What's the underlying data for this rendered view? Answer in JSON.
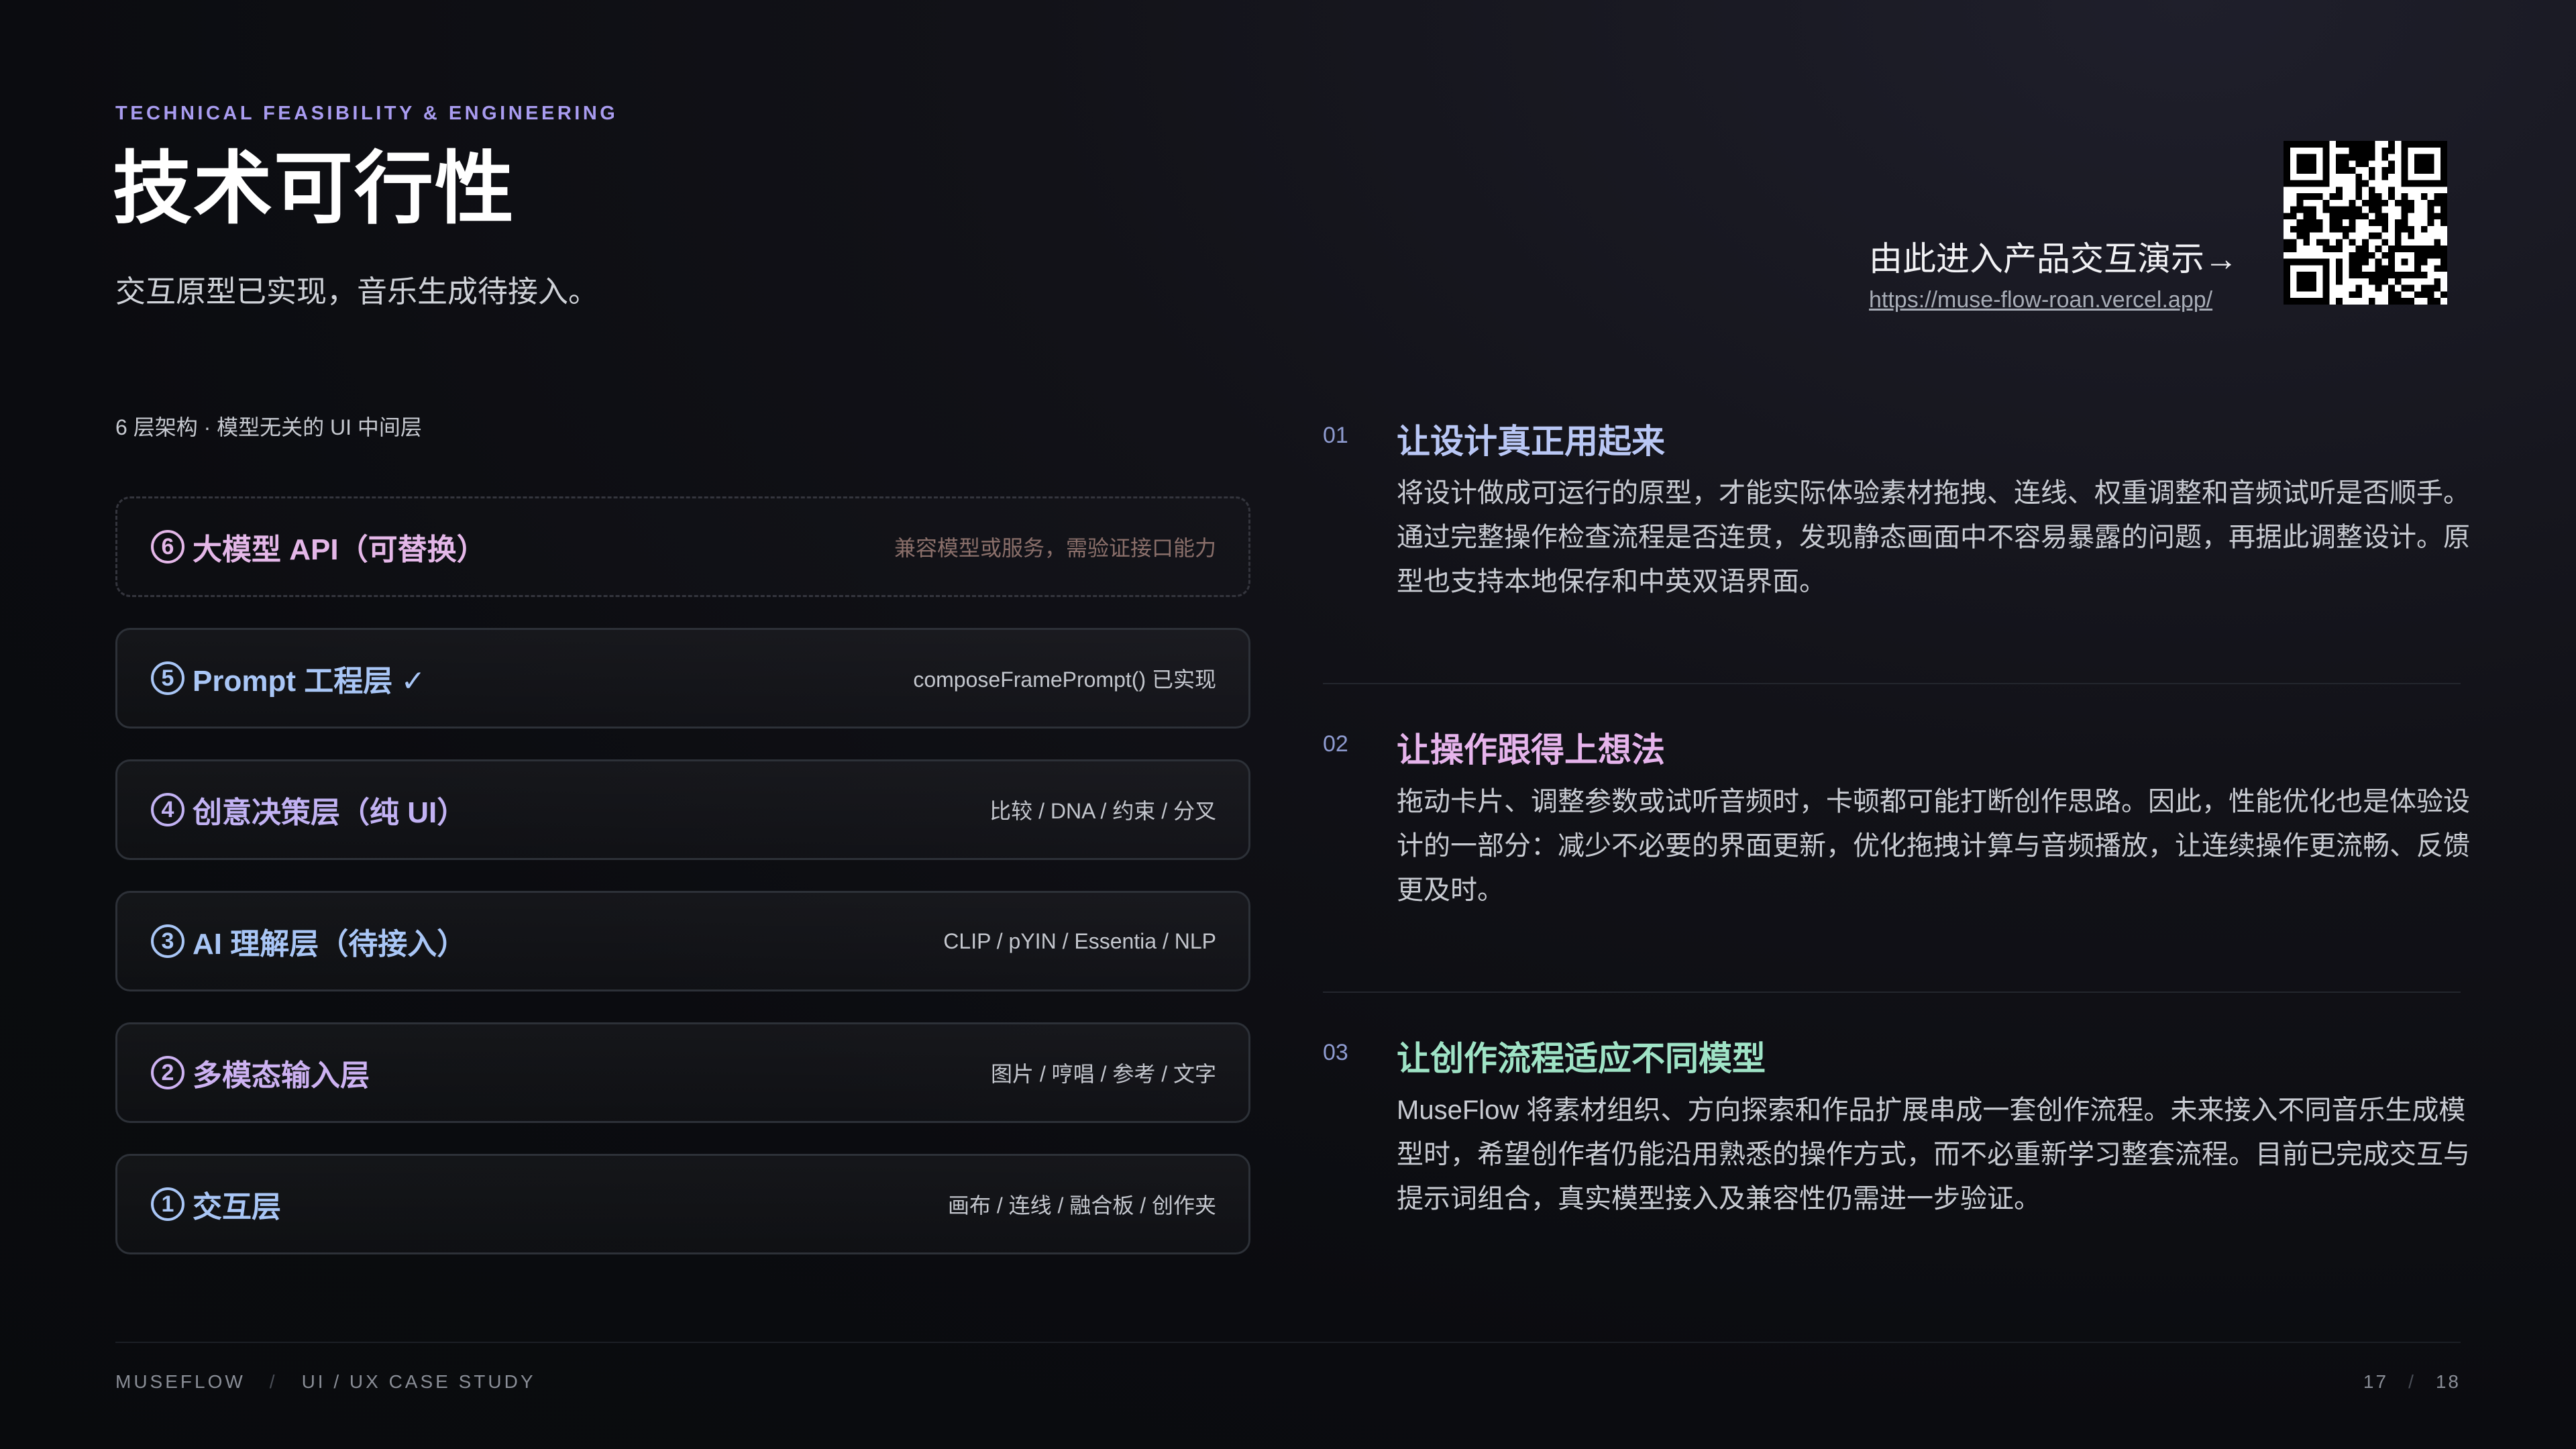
{
  "header": {
    "eyebrow": "TECHNICAL FEASIBILITY & ENGINEERING",
    "title": "技术可行性",
    "subtitle": "交互原型已实现，音乐生成待接入。"
  },
  "demo": {
    "label": "由此进入产品交互演示→",
    "url": "https://muse-flow-roan.vercel.app/",
    "qr_icon": "qr-code-icon"
  },
  "architecture": {
    "caption": "6 层架构 · 模型无关的 UI 中间层",
    "layers": [
      {
        "num": "6",
        "name": "大模型 API（可替换）",
        "detail": "兼容模型或服务，需验证接口能力",
        "color": "#e4b7e8",
        "style": "dashed"
      },
      {
        "num": "5",
        "name": "Prompt 工程层 ✓",
        "detail": "composeFramePrompt() 已实现",
        "color": "#a9c6f6",
        "style": "solid"
      },
      {
        "num": "4",
        "name": "创意决策层（纯 UI）",
        "detail": "比较 / DNA / 约束 / 分叉",
        "color": "#c2b2f3",
        "style": "solid"
      },
      {
        "num": "3",
        "name": "AI 理解层（待接入）",
        "detail": "CLIP / pYIN / Essentia / NLP",
        "color": "#a9c6f6",
        "style": "solid"
      },
      {
        "num": "2",
        "name": "多模态输入层",
        "detail": "图片 / 哼唱 / 参考 / 文字",
        "color": "#cdb2f2",
        "style": "solid"
      },
      {
        "num": "1",
        "name": "交互层",
        "detail": "画布 / 连线 / 融合板 / 创作夹",
        "color": "#a9c6f6",
        "style": "solid"
      }
    ]
  },
  "points": [
    {
      "num": "01",
      "title": "让设计真正用起来",
      "body": "将设计做成可运行的原型，才能实际体验素材拖拽、连线、权重调整和音频试听是否顺手。通过完整操作检查流程是否连贯，发现静态画面中不容易暴露的问题，再据此调整设计。原型也支持本地保存和中英双语界面。",
      "color": "#b9c7f5"
    },
    {
      "num": "02",
      "title": "让操作跟得上想法",
      "body": "拖动卡片、调整参数或试听音频时，卡顿都可能打断创作思路。因此，性能优化也是体验设计的一部分：减少不必要的界面更新，优化拖拽计算与音频播放，让连续操作更流畅、反馈更及时。",
      "color": "#e6b4ec"
    },
    {
      "num": "03",
      "title": "让创作流程适应不同模型",
      "body": "MuseFlow 将素材组织、方向探索和作品扩展串成一套创作流程。未来接入不同音乐生成模型时，希望创作者仍能沿用熟悉的操作方式，而不必重新学习整套流程。目前已完成交互与提示词组合，真实模型接入及兼容性仍需进一步验证。",
      "color": "#9fe3c6"
    }
  ],
  "footer": {
    "brand": "MUSEFLOW",
    "sep": "/",
    "case": "UI / UX CASE STUDY",
    "page": "17",
    "total": "18"
  }
}
